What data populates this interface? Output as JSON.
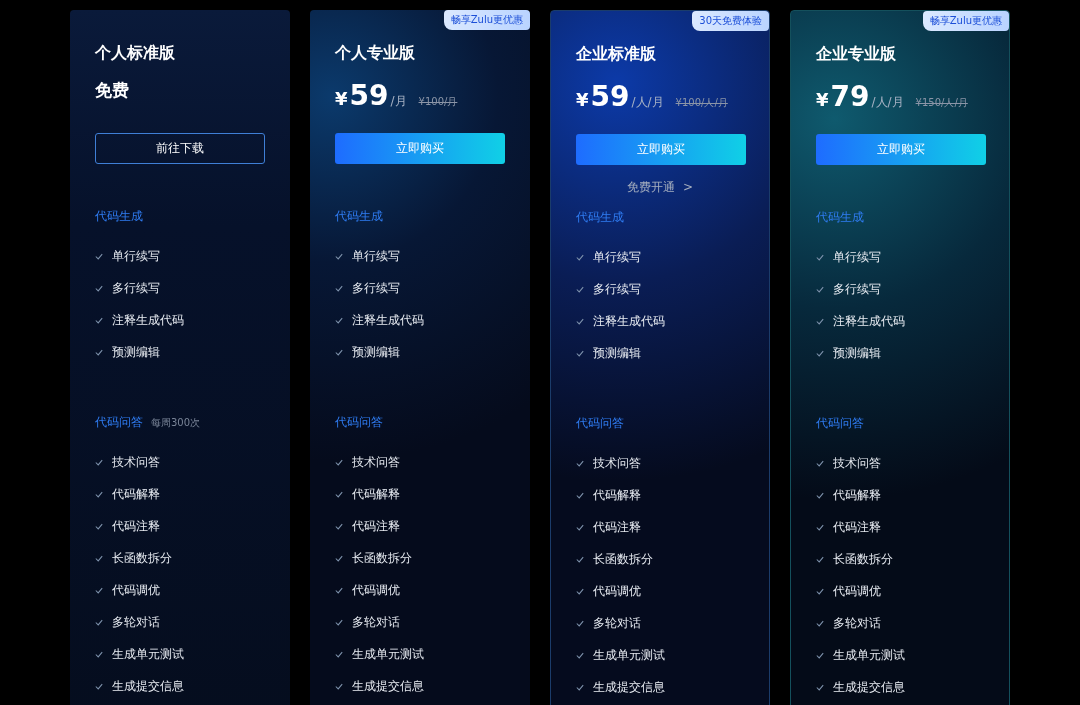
{
  "plans": [
    {
      "name": "个人标准版",
      "price": {
        "text": "免费"
      },
      "button": {
        "label": "前往下载",
        "kind": "outline"
      },
      "sections": [
        {
          "title": "代码生成",
          "features": [
            "单行续写",
            "多行续写",
            "注释生成代码",
            "预测编辑"
          ]
        },
        {
          "title": "代码问答",
          "note": "每周300次",
          "features": [
            "技术问答",
            "代码解释",
            "代码注释",
            "长函数拆分",
            "代码调优",
            "多轮对话",
            "生成单元测试",
            "生成提交信息"
          ]
        }
      ]
    },
    {
      "name": "个人专业版",
      "badge": "畅享Zulu更优惠",
      "price": {
        "currency": "¥",
        "amount": "59",
        "unit": "/月",
        "original": "¥100/月"
      },
      "button": {
        "label": "立即购买",
        "kind": "primary"
      },
      "sections": [
        {
          "title": "代码生成",
          "features": [
            "单行续写",
            "多行续写",
            "注释生成代码",
            "预测编辑"
          ]
        },
        {
          "title": "代码问答",
          "features": [
            "技术问答",
            "代码解释",
            "代码注释",
            "长函数拆分",
            "代码调优",
            "多轮对话",
            "生成单元测试",
            "生成提交信息"
          ]
        }
      ]
    },
    {
      "name": "企业标准版",
      "badge": "30天免费体验",
      "price": {
        "currency": "¥",
        "amount": "59",
        "unit": "/人/月",
        "original": "¥100/人/月"
      },
      "button": {
        "label": "立即购买",
        "kind": "primary"
      },
      "link": {
        "label": "免费开通",
        "arrow": ">"
      },
      "sections": [
        {
          "title": "代码生成",
          "features": [
            "单行续写",
            "多行续写",
            "注释生成代码",
            "预测编辑"
          ]
        },
        {
          "title": "代码问答",
          "features": [
            "技术问答",
            "代码解释",
            "代码注释",
            "长函数拆分",
            "代码调优",
            "多轮对话",
            "生成单元测试",
            "生成提交信息"
          ]
        }
      ]
    },
    {
      "name": "企业专业版",
      "badge": "畅享Zulu更优惠",
      "price": {
        "currency": "¥",
        "amount": "79",
        "unit": "/人/月",
        "original": "¥150/人/月"
      },
      "button": {
        "label": "立即购买",
        "kind": "primary"
      },
      "sections": [
        {
          "title": "代码生成",
          "features": [
            "单行续写",
            "多行续写",
            "注释生成代码",
            "预测编辑"
          ]
        },
        {
          "title": "代码问答",
          "features": [
            "技术问答",
            "代码解释",
            "代码注释",
            "长函数拆分",
            "代码调优",
            "多轮对话",
            "生成单元测试",
            "生成提交信息"
          ]
        }
      ]
    }
  ]
}
